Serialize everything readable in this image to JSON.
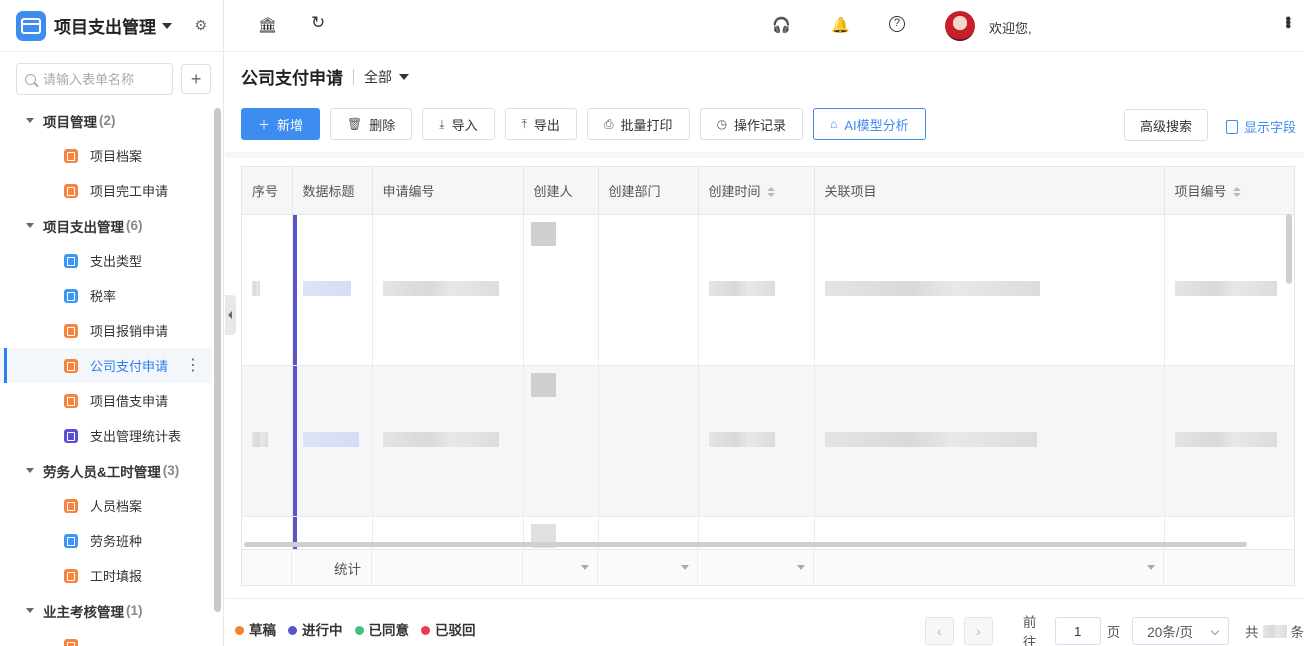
{
  "sidebar": {
    "app_title": "项目支出管理",
    "search_placeholder": "请输入表单名称",
    "groups": [
      {
        "label": "项目管理",
        "count": "(2)",
        "items": [
          {
            "label": "项目档案",
            "icon": "orange"
          },
          {
            "label": "项目完工申请",
            "icon": "orange"
          }
        ]
      },
      {
        "label": "项目支出管理",
        "count": "(6)",
        "items": [
          {
            "label": "支出类型",
            "icon": "blue"
          },
          {
            "label": "税率",
            "icon": "blue"
          },
          {
            "label": "项目报销申请",
            "icon": "orange"
          },
          {
            "label": "公司支付申请",
            "icon": "orange",
            "active": true
          },
          {
            "label": "项目借支申请",
            "icon": "orange"
          },
          {
            "label": "支出管理统计表",
            "icon": "purple"
          }
        ]
      },
      {
        "label": "劳务人员&工时管理",
        "count": "(3)",
        "items": [
          {
            "label": "人员档案",
            "icon": "orange"
          },
          {
            "label": "劳务班种",
            "icon": "blue"
          },
          {
            "label": "工时填报",
            "icon": "orange"
          }
        ]
      },
      {
        "label": "业主考核管理",
        "count": "(1)",
        "items": []
      }
    ]
  },
  "topbar": {
    "welcome": "欢迎您,",
    "icons": [
      "bank-icon",
      "refresh-icon",
      "headset-icon",
      "bell-icon",
      "help-icon"
    ]
  },
  "page": {
    "title": "公司支付申请",
    "filter": "全部"
  },
  "toolbar": {
    "add": "新增",
    "delete": "删除",
    "import": "导入",
    "export": "导出",
    "batch_print": "批量打印",
    "op_log": "操作记录",
    "ai": "AI模型分析",
    "advanced_search": "高级搜索",
    "show_fields": "显示字段"
  },
  "table": {
    "columns": [
      "序号",
      "数据标题",
      "申请编号",
      "创建人",
      "创建部门",
      "创建时间",
      "关联项目",
      "项目编号"
    ],
    "stats_label": "统计"
  },
  "legend": [
    {
      "label": "草稿",
      "color": "#f5822c"
    },
    {
      "label": "进行中",
      "color": "#5553c8"
    },
    {
      "label": "已同意",
      "color": "#43c07a"
    },
    {
      "label": "已驳回",
      "color": "#ee3a4a"
    }
  ],
  "pager": {
    "goto": "前往",
    "page": "1",
    "page_unit": "页",
    "page_size": "20条/页",
    "total_prefix": "共",
    "total_suffix": "条"
  },
  "colors": {
    "accent": "#3d8cf0",
    "active_bg": "#f3f6fb"
  }
}
